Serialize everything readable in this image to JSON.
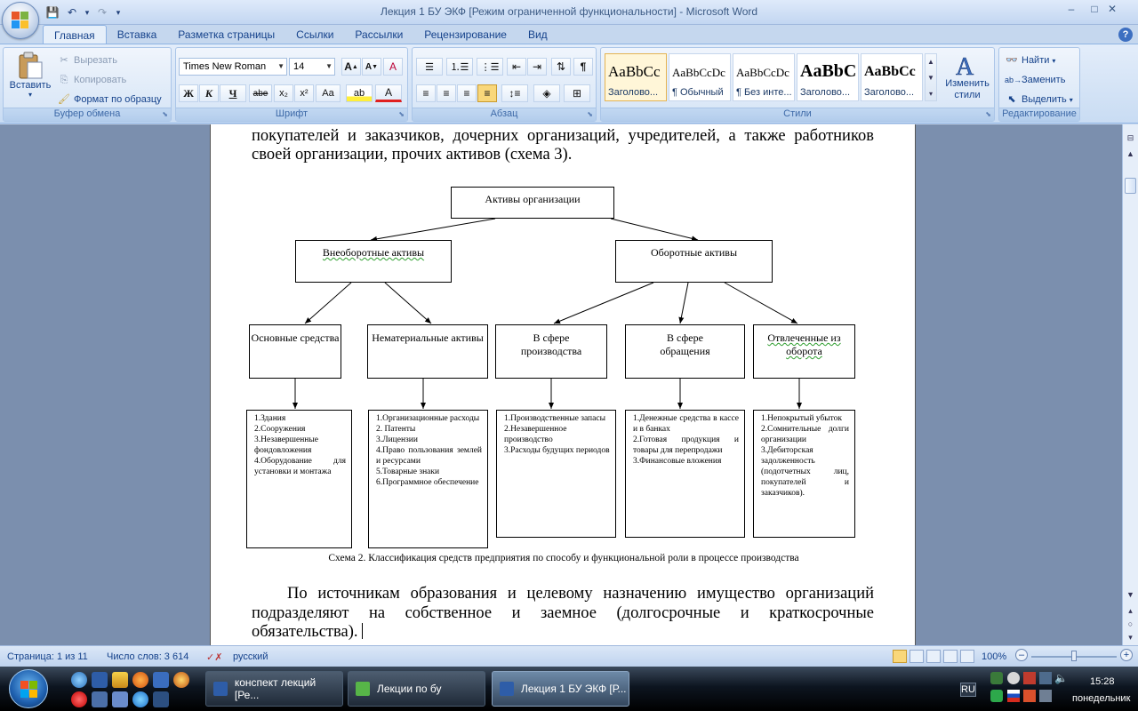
{
  "window": {
    "title": "Лекция 1 БУ ЭКФ [Режим ограниченной функциональности] - Microsoft Word",
    "controls": {
      "minimize": "–",
      "maximize": "□",
      "close": "✕"
    },
    "ribbon_minimize": "–",
    "ribbon_restore": "⧉",
    "ribbon_close": "✕"
  },
  "qat": {
    "save": "💾",
    "undo": "↶",
    "undo_arrow": "▾",
    "redo": "↷",
    "customize": "▾"
  },
  "tabs": [
    "Главная",
    "Вставка",
    "Разметка страницы",
    "Ссылки",
    "Рассылки",
    "Рецензирование",
    "Вид"
  ],
  "help": "?",
  "clipboard": {
    "paste": "Вставить",
    "paste_arrow": "▾",
    "cut": "Вырезать",
    "copy": "Копировать",
    "format_painter": "Формат по образцу",
    "title": "Буфер обмена"
  },
  "font": {
    "name": "Times New Roman",
    "size": "14",
    "grow": "A",
    "shrink": "A",
    "clear": "A",
    "bold": "Ж",
    "italic": "К",
    "underline": "Ч",
    "strike": "abe",
    "subscript": "x₂",
    "superscript": "x²",
    "case": "Aa",
    "highlight": "ab",
    "color": "A",
    "title": "Шрифт"
  },
  "paragraph": {
    "title": "Абзац",
    "pilcrow": "¶"
  },
  "styles": {
    "title": "Стили",
    "items": [
      {
        "sample": "AaBbCc",
        "name": "Заголово..."
      },
      {
        "sample": "AaBbCcDc",
        "name": "¶ Обычный"
      },
      {
        "sample": "AaBbCcDc",
        "name": "¶ Без инте..."
      },
      {
        "sample": "AaBbC",
        "name": "Заголово..."
      },
      {
        "sample": "AaBbCc",
        "name": "Заголово..."
      }
    ],
    "change_styles": "Изменить стили",
    "change_arrow": "▾"
  },
  "editing": {
    "title": "Редактирование",
    "find": "Найти",
    "replace": "Заменить",
    "select": "Выделить"
  },
  "document": {
    "top_line1": "покупателей и заказчиков, дочерних организаций, учредителей, а также работников",
    "top_line2": "своей организации, прочих активов (схема 3).",
    "diagram": {
      "root": "Активы организации",
      "left": "Внеоборотные активы",
      "right": "Оборотные активы",
      "level2": [
        "Основные средства",
        "Нематериальные активы",
        "В сфере производства",
        "В сфере обращения",
        "Отвлеченные из оборота"
      ],
      "lists": [
        [
          "1.Здания",
          "2.Сооружения",
          "3.Незавершенные фондовложения",
          "4.Оборудование для установки и монтажа"
        ],
        [
          "1.Организационные расходы",
          "2. Патенты",
          "3.Лицензии",
          "4.Право пользования землей и ресурсами",
          "5.Товарные знаки",
          "6.Программное обеспечение"
        ],
        [
          "1.Производственные запасы",
          "2.Незавершенное производство",
          "3.Расходы будущих периодов"
        ],
        [
          "1.Денежные средства в кассе и в банках",
          "2.Готовая продукция и товары для перепродажи",
          "3.Финансовые вложения"
        ],
        [
          "1.Непокрытый убыток",
          "2.Сомнительные долги организации",
          "3.Дебиторская задолженность (подотчетных лиц, покупателей и заказчиков)."
        ]
      ]
    },
    "caption": "Схема 2. Классификация средств предприятия по способу и функциональной роли в процессе производства",
    "para_line1": "По источникам образования и целевому назначению имущество организаций",
    "para_line2": "подразделяют на собственное и заемное (долгосрочные и краткосрочные",
    "para_line3": "обязательства)."
  },
  "status": {
    "page": "Страница: 1 из 11",
    "words": "Число слов: 3 614",
    "lang": "русский",
    "zoom": "100%",
    "zoom_out": "–",
    "zoom_in": "+",
    "zoom_level": 0.5
  },
  "taskbar": {
    "tasks": [
      "конспект лекций [Ре...",
      "Лекции по бу",
      "Лекция 1 БУ ЭКФ [Р..."
    ],
    "lang": "RU",
    "time": "15:28",
    "day": "понедельник"
  },
  "colors": {
    "ribbon_text": "#15428b",
    "accent": "#2b579a",
    "selected_style": "#fff6d8"
  }
}
